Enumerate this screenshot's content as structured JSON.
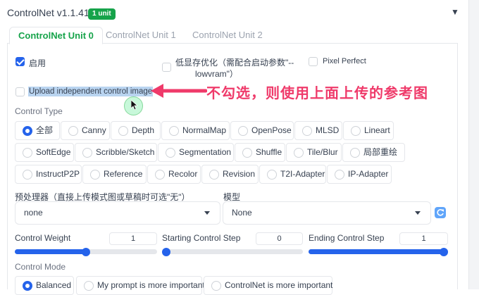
{
  "header": {
    "title": "ControlNet v1.1.417",
    "badge": "1 unit",
    "collapse_icon": "triangle-down-icon"
  },
  "tabs": [
    {
      "label": "ControlNet Unit 0",
      "active": true
    },
    {
      "label": "ControlNet Unit 1",
      "active": false
    },
    {
      "label": "ControlNet Unit 2",
      "active": false
    }
  ],
  "options": {
    "enable": {
      "label": "启用",
      "checked": true
    },
    "low_vram": {
      "label_line1": "低显存优化（需配合启动参数\"--",
      "label_line2": "lowvram\"）",
      "checked": false
    },
    "pixel_perfect": {
      "label": "Pixel Perfect",
      "checked": false
    },
    "upload_independent": {
      "label": "Upload independent control image",
      "checked": false
    }
  },
  "annotation": {
    "text": "不勾选，则使用上面上传的参考图",
    "color": "#ef3a6a"
  },
  "control_type": {
    "label": "Control Type",
    "rows": [
      [
        "全部",
        "Canny",
        "Depth",
        "NormalMap",
        "OpenPose",
        "MLSD",
        "Lineart"
      ],
      [
        "SoftEdge",
        "Scribble/Sketch",
        "Segmentation",
        "Shuffle",
        "Tile/Blur",
        "局部重绘"
      ],
      [
        "InstructP2P",
        "Reference",
        "Recolor",
        "Revision",
        "T2I-Adapter",
        "IP-Adapter"
      ]
    ],
    "selected": "全部"
  },
  "preprocessor": {
    "label": "预处理器（直接上传模式图或草稿时可选\"无\"）",
    "value": "none"
  },
  "model": {
    "label": "模型",
    "value": "None",
    "refresh_icon": "refresh-icon"
  },
  "sliders": {
    "control_weight": {
      "label": "Control Weight",
      "value": "1",
      "fraction": 0.5
    },
    "starting_step": {
      "label": "Starting Control Step",
      "value": "0",
      "fraction": 0.0
    },
    "ending_step": {
      "label": "Ending Control Step",
      "value": "1",
      "fraction": 1.0
    }
  },
  "control_mode": {
    "label": "Control Mode",
    "options": [
      "Balanced",
      "My prompt is more important",
      "ControlNet is more important"
    ],
    "selected": "Balanced"
  },
  "colors": {
    "accent": "#2563eb",
    "active_tab": "#16a34a",
    "badge_bg": "#16a34a",
    "highlight": "#b9d4f0"
  }
}
